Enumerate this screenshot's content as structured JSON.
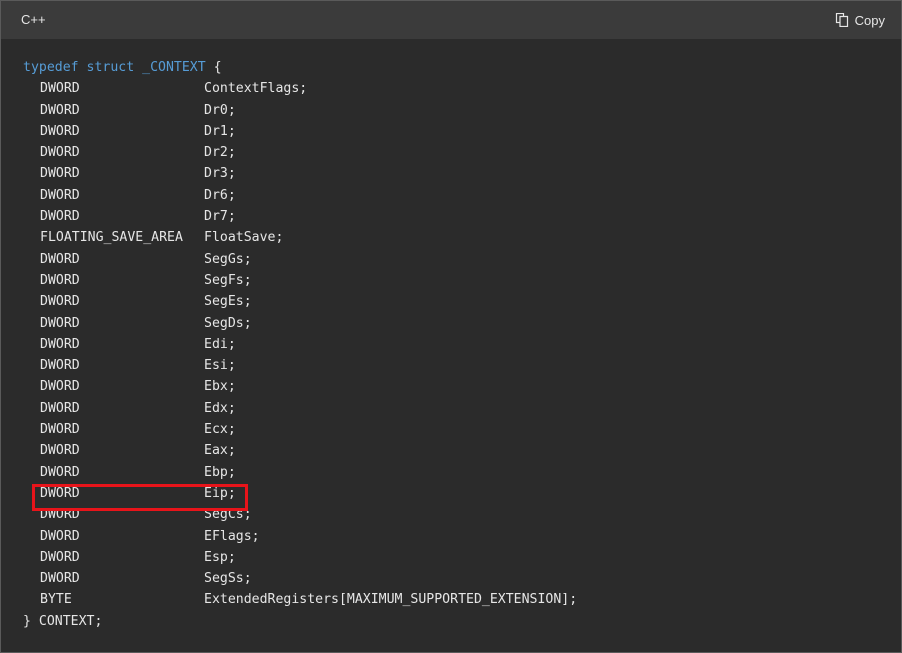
{
  "header": {
    "language": "C++",
    "copy_label": "Copy",
    "copy_icon": "copy-icon"
  },
  "code": {
    "open": {
      "kw1": "typedef",
      "kw2": "struct",
      "name": "_CONTEXT",
      "brace": "{"
    },
    "fields": [
      {
        "type": "DWORD",
        "name": "ContextFlags;"
      },
      {
        "type": "DWORD",
        "name": "Dr0;"
      },
      {
        "type": "DWORD",
        "name": "Dr1;"
      },
      {
        "type": "DWORD",
        "name": "Dr2;"
      },
      {
        "type": "DWORD",
        "name": "Dr3;"
      },
      {
        "type": "DWORD",
        "name": "Dr6;"
      },
      {
        "type": "DWORD",
        "name": "Dr7;"
      },
      {
        "type": "FLOATING_SAVE_AREA",
        "name": "FloatSave;"
      },
      {
        "type": "DWORD",
        "name": "SegGs;"
      },
      {
        "type": "DWORD",
        "name": "SegFs;"
      },
      {
        "type": "DWORD",
        "name": "SegEs;"
      },
      {
        "type": "DWORD",
        "name": "SegDs;"
      },
      {
        "type": "DWORD",
        "name": "Edi;"
      },
      {
        "type": "DWORD",
        "name": "Esi;"
      },
      {
        "type": "DWORD",
        "name": "Ebx;"
      },
      {
        "type": "DWORD",
        "name": "Edx;"
      },
      {
        "type": "DWORD",
        "name": "Ecx;"
      },
      {
        "type": "DWORD",
        "name": "Eax;"
      },
      {
        "type": "DWORD",
        "name": "Ebp;"
      },
      {
        "type": "DWORD",
        "name": "Eip;"
      },
      {
        "type": "DWORD",
        "name": "SegCs;"
      },
      {
        "type": "DWORD",
        "name": "EFlags;"
      },
      {
        "type": "DWORD",
        "name": "Esp;"
      },
      {
        "type": "DWORD",
        "name": "SegSs;"
      },
      {
        "type": "BYTE",
        "name": "ExtendedRegisters[MAXIMUM_SUPPORTED_EXTENSION];"
      }
    ],
    "close": "} CONTEXT;",
    "highlighted_field": "Eip;"
  },
  "colors": {
    "keyword": "#569cd6",
    "highlight_border": "#e8141a",
    "background": "#2b2b2b",
    "header_background": "#3b3b3b"
  }
}
